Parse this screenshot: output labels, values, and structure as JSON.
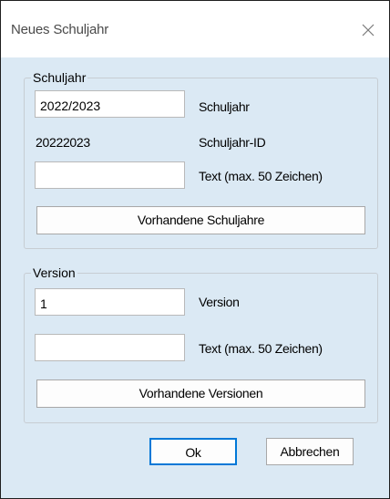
{
  "window": {
    "title": "Neues Schuljahr",
    "close_icon": "close-icon"
  },
  "schuljahr_group": {
    "legend": "Schuljahr",
    "schuljahr_value": "2022/2023",
    "schuljahr_label": "Schuljahr",
    "id_value": "20222023",
    "id_label": "Schuljahr-ID",
    "text_value": "",
    "text_label": "Text (max. 50 Zeichen)",
    "existing_button": "Vorhandene Schuljahre"
  },
  "version_group": {
    "legend": "Version",
    "version_value": "1",
    "version_label": "Version",
    "text_value": "",
    "text_label": "Text (max. 50 Zeichen)",
    "existing_button": "Vorhandene Versionen"
  },
  "actions": {
    "ok_label": "Ok",
    "cancel_label": "Abbrechen"
  },
  "colors": {
    "dialog_background": "#dbe9f4",
    "titlebar_background": "#ffffff",
    "default_button_border": "#0078d7"
  }
}
